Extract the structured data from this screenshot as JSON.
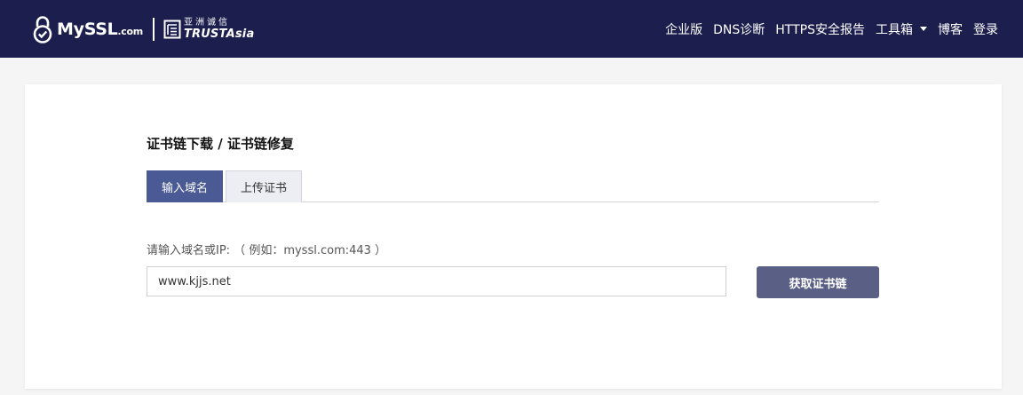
{
  "header": {
    "logo": {
      "name": "MySSL",
      "tld": ".com",
      "partner_cn": "亚洲诚信",
      "partner_en": "TRUSTAsia"
    },
    "nav": [
      {
        "label": "企业版"
      },
      {
        "label": "DNS诊断"
      },
      {
        "label": "HTTPS安全报告"
      },
      {
        "label": "工具箱",
        "has_dropdown": true
      },
      {
        "label": "博客"
      },
      {
        "label": "登录"
      }
    ]
  },
  "main": {
    "title": "证书链下载 / 证书链修复",
    "tabs": [
      {
        "label": "输入域名",
        "active": true
      },
      {
        "label": "上传证书",
        "active": false
      }
    ],
    "form": {
      "hint": "请输入域名或IP: （ 例如：myssl.com:443 ）",
      "domain_value": "www.kjjs.net",
      "submit_label": "获取证书链"
    }
  },
  "colors": {
    "header_bg": "#1c1f4d",
    "tab_active": "#4a5a94",
    "button": "#5a5f85"
  }
}
